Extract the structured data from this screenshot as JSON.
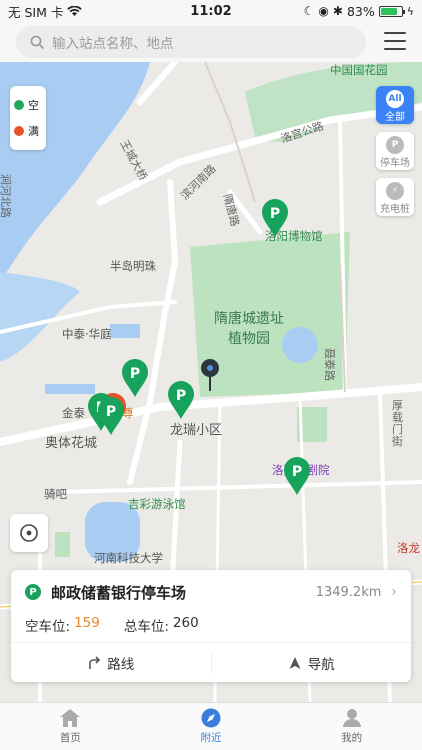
{
  "status_bar": {
    "carrier": "无 SIM 卡",
    "time": "11:02",
    "battery": "83%",
    "battery_level": 0.83
  },
  "search": {
    "placeholder": "输入站点名称、地点"
  },
  "legend": {
    "free": "空",
    "full": "满",
    "free_color": "#23a85a",
    "full_color": "#e3532a"
  },
  "filters": [
    {
      "icon_text": "All",
      "label": "全部",
      "active": true
    },
    {
      "icon_text": "P",
      "label": "停车场",
      "active": false
    },
    {
      "icon_text": "⚡",
      "label": "充电桩",
      "active": false
    }
  ],
  "map_labels": {
    "flower_garden": "中国国花园",
    "luopu_road": "洛宫公路",
    "wangcheng_bridge": "王城大桥",
    "binhe_south": "滨河南路",
    "sui_tang_road": "隋唐路",
    "museum": "洛阳博物馆",
    "peninsula": "半岛明珠",
    "jianhe_north": "涧河北路",
    "zhongtai": "中泰·华庭",
    "park_line1": "隋唐城遗址",
    "park_line2": "植物园",
    "nietai_road": "聂泰路",
    "jintai": "金泰",
    "zunzun": "尊",
    "longrui": "龙瑞小区",
    "aoti": "奥体花城",
    "houzai_street": "厚载门街",
    "opera": "洛阳歌剧院",
    "qiba": "骑吧",
    "jicai_pool": "吉彩游泳馆",
    "henan_univ": "河南科技大学",
    "luolong": "洛龙"
  },
  "info_card": {
    "name": "邮政储蓄银行停车场",
    "distance": "1349.2km",
    "free_label": "空车位:",
    "free_value": "159",
    "total_label": "总车位:",
    "total_value": "260",
    "route_label": "路线",
    "nav_label": "导航"
  },
  "tabs": [
    {
      "label": "首页",
      "active": false
    },
    {
      "label": "附近",
      "active": true
    },
    {
      "label": "我的",
      "active": false
    }
  ]
}
